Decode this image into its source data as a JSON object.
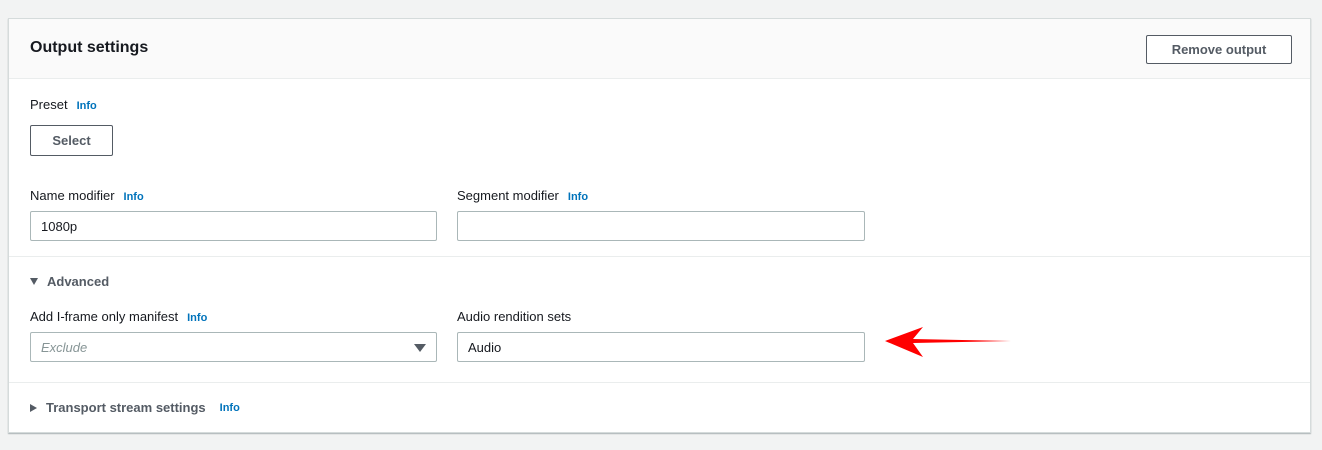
{
  "panel": {
    "title": "Output settings",
    "remove_button": "Remove output"
  },
  "preset": {
    "label": "Preset",
    "info": "Info",
    "button": "Select"
  },
  "name_modifier": {
    "label": "Name modifier",
    "info": "Info",
    "value": "1080p"
  },
  "segment_modifier": {
    "label": "Segment modifier",
    "info": "Info",
    "value": ""
  },
  "advanced": {
    "label": "Advanced",
    "expanded": true,
    "iframe_manifest": {
      "label": "Add I-frame only manifest",
      "info": "Info",
      "placeholder": "Exclude"
    },
    "audio_rendition_sets": {
      "label": "Audio rendition sets",
      "value": "Audio"
    }
  },
  "transport_stream": {
    "label": "Transport stream settings",
    "info": "Info",
    "expanded": false
  },
  "annotation": {
    "arrow_color": "#ff0000"
  }
}
